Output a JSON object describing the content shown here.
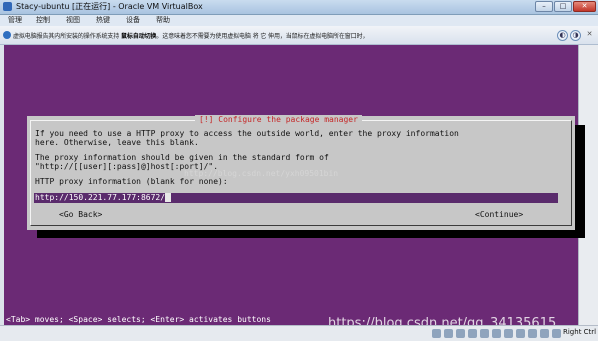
{
  "window": {
    "title": "Stacy-ubuntu [正在运行] - Oracle VM VirtualBox",
    "min_glyph": "–",
    "max_glyph": "□",
    "close_glyph": "✕"
  },
  "menu": [
    "管理",
    "控制",
    "视图",
    "热键",
    "设备",
    "帮助"
  ],
  "notification": {
    "text_before": "虚拟电脑报告其内所安装的操作系统支持 ",
    "text_bold": "鼠标自动切换",
    "text_after": "。这意味着您不需要为使用虚拟电脑 将 它 伸用，当鼠标在虚拟电脑所在窗口时，",
    "btn1_glyph": "◐",
    "btn2_glyph": "◑",
    "close_glyph": "✕"
  },
  "dialog": {
    "title": "[!] Configure the package manager",
    "lines": [
      "If you need to use a HTTP proxy to access the outside world, enter the proxy information",
      "here. Otherwise, leave this blank.",
      "The proxy information should be given in the standard form of",
      "\"http://[[user][:pass]@]host[:port]/\".",
      "HTTP proxy information (blank for none):"
    ],
    "proxy_value": "http://150.221.77.177:8672/",
    "go_back": "<Go Back>",
    "continue": "<Continue>",
    "watermark": "http://blog.csdn.net/yxh09501bin"
  },
  "hint": "<Tab> moves; <Space> selects; <Enter> activates buttons",
  "blog_watermark": "https://blog.csdn.net/qq_34135615",
  "status": {
    "host_key": "Right Ctrl"
  }
}
